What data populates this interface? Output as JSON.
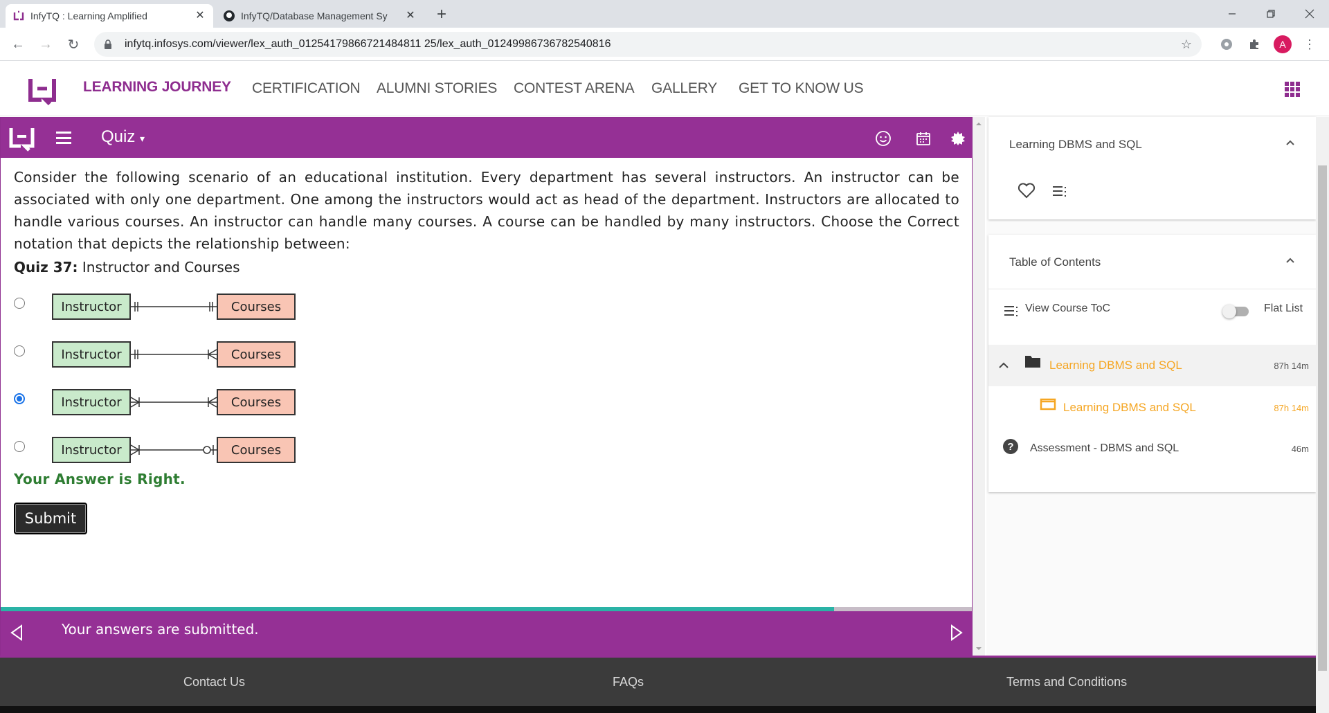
{
  "browser": {
    "tabs": [
      {
        "title": "InfyTQ : Learning Amplified",
        "active": true
      },
      {
        "title": "InfyTQ/Database Management Sy",
        "active": false
      }
    ],
    "url": "infytq.infosys.com/viewer/lex_auth_01254179866721484811 25/lex_auth_01249986736782540816",
    "avatar_letter": "A"
  },
  "site_nav": {
    "items": [
      "LEARNING JOURNEY",
      "CERTIFICATION",
      "ALUMNI STORIES",
      "CONTEST ARENA",
      "GALLERY",
      "GET TO KNOW US"
    ],
    "active_index": 0,
    "brand_color": "#8e2d8f"
  },
  "player": {
    "title": "Quiz",
    "question": "Consider the following scenario of an educational institution. Every department has several instructors. An instructor can be associated with only one department. One among the instructors would act as head of the department. Instructors are allocated to handle various courses. An instructor can handle many courses. A course can be handled by many instructors. Choose the Correct notation that depicts the relationship between:",
    "quiz_label": "Quiz 37:",
    "quiz_subject": "Instructor and Courses",
    "options": [
      {
        "left": "Instructor",
        "right": "Courses",
        "left_end": "one-and-only-one",
        "right_end": "one-and-only-one",
        "selected": false
      },
      {
        "left": "Instructor",
        "right": "Courses",
        "left_end": "one-and-only-one",
        "right_end": "one-or-many",
        "selected": false
      },
      {
        "left": "Instructor",
        "right": "Courses",
        "left_end": "one-or-many",
        "right_end": "one-or-many",
        "selected": true
      },
      {
        "left": "Instructor",
        "right": "Courses",
        "left_end": "one-or-many",
        "right_end": "zero-or-one",
        "selected": false
      }
    ],
    "result_text": "Your Answer is Right.",
    "submit_label": "Submit",
    "progress_fraction": 0.858,
    "status_message": "Your answers are submitted."
  },
  "right_panel": {
    "course_title": "Learning DBMS and SQL",
    "toc_title": "Table of Contents",
    "view_toc_label": "View Course ToC",
    "flat_list_label": "Flat List",
    "toc_items": [
      {
        "label": "Learning DBMS and SQL",
        "duration": "87h 14m"
      },
      {
        "label": "Learning DBMS and SQL",
        "duration": "87h 14m"
      },
      {
        "label": "Assessment - DBMS and SQL",
        "duration": "46m"
      }
    ]
  },
  "footer": {
    "links": [
      "Contact Us",
      "FAQs",
      "Terms and Conditions"
    ]
  }
}
